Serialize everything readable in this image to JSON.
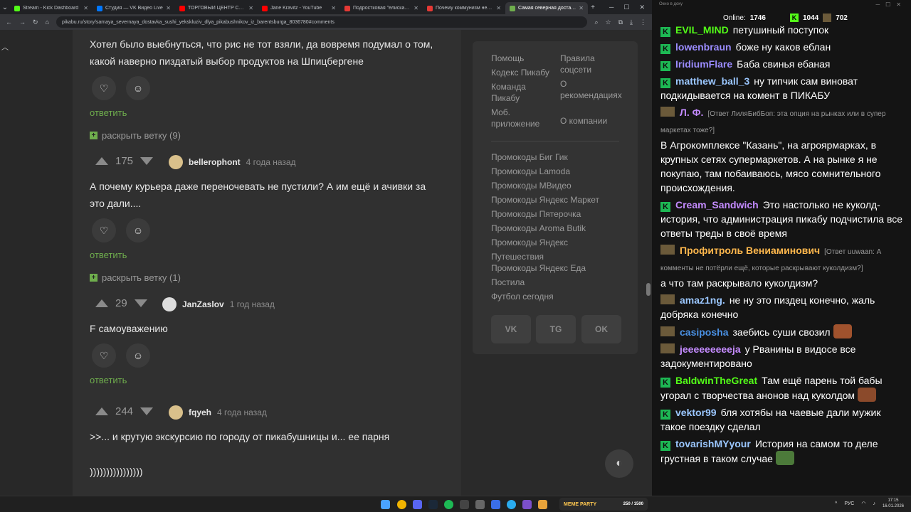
{
  "browser": {
    "tabs": [
      {
        "title": "Stream - Kick Dashboard",
        "color": "#53fc18"
      },
      {
        "title": "Студия — VK Видео Live",
        "color": "#0077ff"
      },
      {
        "title": "ТОРГОВЫЙ ЦЕНТР СМЕРТИ",
        "color": "#ff0000"
      },
      {
        "title": "Jane Kravitz - YouTube",
        "color": "#ff0000"
      },
      {
        "title": "Подростковая \"елиска\", ко",
        "color": "#e53935"
      },
      {
        "title": "Почему коммунизм не раб",
        "color": "#e53935"
      },
      {
        "title": "Самая северная доставка с",
        "color": "#6fae4d",
        "active": true
      }
    ],
    "url": "pikabu.ru/story/samaya_severnaya_dostavka_sushi_yekskluziv_dlya_pikabushnikov_iz_barentsburga_8036780#comments"
  },
  "feed": {
    "c0_text1": "Хотел было выебнуться, что рис не тот взяли, да вовремя подумал о том,",
    "c0_text2": "какой наверно пиздатый выбор продуктов на Шпицбергене",
    "reply": "ответить",
    "expand1": "раскрыть ветку (9)",
    "c1": {
      "score": "175",
      "author": "bellerophont",
      "time": "4 года назад",
      "text1": "А почему курьера даже переночевать не пустили? А им ещё и ачивки за",
      "text2": "это дали...."
    },
    "expand2": "раскрыть ветку (1)",
    "c2": {
      "score": "29",
      "author": "JanZaslov",
      "time": "1 год назад",
      "text1": "F самоуважению"
    },
    "c3": {
      "score": "244",
      "author": "fqyeh",
      "time": "4 года назад",
      "text1": ">>... и крутую экскурсию по городу от пикабушницы и... ее парня",
      "text2": "))))))))))))))))"
    }
  },
  "sidebar": {
    "col1": [
      "Помощь",
      "Кодекс Пикабу",
      "Команда Пикабу",
      "Моб. приложение"
    ],
    "col2": [
      "Правила соцсети",
      "О рекомендациях",
      "О компании"
    ],
    "promos": [
      "Промокоды Биг Гик",
      "Промокоды Lamoda",
      "Промокоды МВидео",
      "Промокоды Яндекс Маркет",
      "Промокоды Пятерочка",
      "Промокоды Aroma Butik",
      "Промокоды Яндекс Путешествия",
      "Промокоды Яндекс Еда",
      "Постила",
      "Футбол сегодня"
    ],
    "social": [
      "VK",
      "TG",
      "OK"
    ]
  },
  "chat": {
    "title": "Окно в доку",
    "online_label": "Online:",
    "online": "1746",
    "followers": "1044",
    "subs": "702",
    "messages": [
      {
        "user": "EVIL_MIND",
        "color": "#53fc18",
        "text": "петушиный поступок",
        "badge": "kick"
      },
      {
        "user": "lowenbraun",
        "color": "#9b8cff",
        "text": "боже ну каков еблан",
        "badge": "kick"
      },
      {
        "user": "IridiumFlare",
        "color": "#9b8cff",
        "text": "Баба свинья ебаная",
        "badge": "kick"
      },
      {
        "user": "matthew_ball_3",
        "color": "#9bc7ff",
        "text": "ну типчик сам виноват подкидывается на комент в ПИКАБУ",
        "badge": "kick"
      },
      {
        "user": "Л. Ф.",
        "color": "#c48bff",
        "reply": "[Ответ ЛиляБибБоп: эта опция на рынках или в супер маркетах тоже?]",
        "text": "В Агрокомплексе \"Казань\", на агроярмарках, в крупных сетях супермаркетов. А на рынке я не покупаю, там побаиваюсь, мясо сомнительного происхождения.",
        "badge": "mus"
      },
      {
        "user": "Cream_Sandwich",
        "color": "#c48bff",
        "text": "Это настолько не куколд-история, что администрация пикабу подчистила все ответы треды в своё время",
        "badge": "kick"
      },
      {
        "user": "Профитроль Вениаминович",
        "color": "#ffb84d",
        "reply": "[Ответ uuwaan: А комменты не потёрли ещё, которые раскрывают куколдизм?]",
        "text": "а что там раскрывало куколдизм?",
        "badge": "mus"
      },
      {
        "user": "amaz1ng.",
        "color": "#9bc7ff",
        "text": "не ну это пиздец конечно, жаль добряка конечно",
        "badge": "mus"
      },
      {
        "user": "casiposha",
        "color": "#4a90e2",
        "text": "заебись суши свозил",
        "badge": "mus",
        "emote": "#a0522d"
      },
      {
        "user": "jeeeeeeeeeja",
        "color": "#c48bff",
        "text": "у Рванины в видосе все задокументировано",
        "badge": "mus"
      },
      {
        "user": "BaldwinTheGreat",
        "color": "#53fc18",
        "text": "Там ещё парень той бабы угорал с творчества анонов над куколдом",
        "badge": "kick",
        "emote": "#8b4a2b"
      },
      {
        "user": "vektor99",
        "color": "#9bc7ff",
        "text": "бля хотябы на чаевые дали мужик такое поездку сделал",
        "badge": "kick"
      },
      {
        "user": "tovarishMYyour",
        "color": "#9bc7ff",
        "text": "История на самом то деле грустная в таком случае",
        "badge": "kick",
        "emote": "#4c7a3a"
      }
    ]
  },
  "taskbar": {
    "promo_label": "MEME PARTY",
    "promo_count": "250 / 1500",
    "lang": "РУС",
    "time": "17:15",
    "date": "16.01.2026"
  }
}
